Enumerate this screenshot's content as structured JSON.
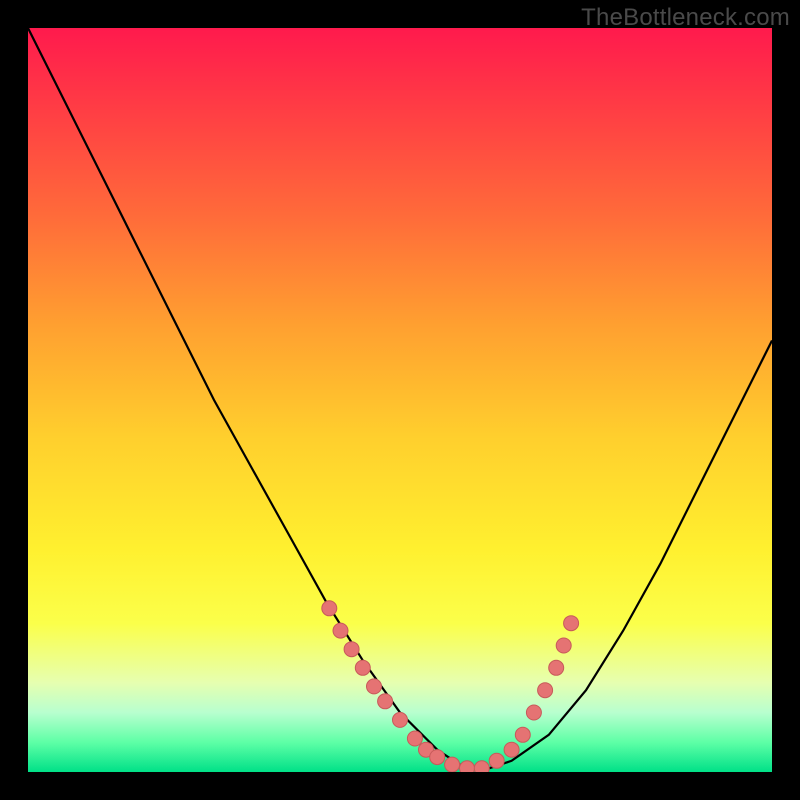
{
  "watermark": "TheBottleneck.com",
  "colors": {
    "page_bg": "#000000",
    "gradient_top": "#ff1a4d",
    "gradient_bottom": "#00e188",
    "curve": "#000000",
    "dot_fill": "#e57373",
    "dot_stroke": "#c75a5a"
  },
  "chart_data": {
    "type": "line",
    "title": "",
    "xlabel": "",
    "ylabel": "",
    "xlim": [
      0,
      100
    ],
    "ylim": [
      0,
      100
    ],
    "grid": false,
    "series": [
      {
        "name": "bottleneck-curve",
        "x": [
          0,
          5,
          10,
          15,
          20,
          25,
          30,
          35,
          40,
          45,
          50,
          55,
          58,
          60,
          62,
          65,
          70,
          75,
          80,
          85,
          90,
          95,
          100
        ],
        "y": [
          100,
          90,
          80,
          70,
          60,
          50,
          41,
          32,
          23,
          15,
          8,
          3,
          1,
          0.5,
          0.5,
          1.5,
          5,
          11,
          19,
          28,
          38,
          48,
          58
        ]
      }
    ],
    "highlight_region_x": [
      40,
      72
    ],
    "highlight_points": [
      {
        "x": 40.5,
        "y": 22
      },
      {
        "x": 42.0,
        "y": 19
      },
      {
        "x": 43.5,
        "y": 16.5
      },
      {
        "x": 45.0,
        "y": 14
      },
      {
        "x": 46.5,
        "y": 11.5
      },
      {
        "x": 48.0,
        "y": 9.5
      },
      {
        "x": 50.0,
        "y": 7
      },
      {
        "x": 52.0,
        "y": 4.5
      },
      {
        "x": 53.5,
        "y": 3
      },
      {
        "x": 55.0,
        "y": 2
      },
      {
        "x": 57.0,
        "y": 1
      },
      {
        "x": 59.0,
        "y": 0.5
      },
      {
        "x": 61.0,
        "y": 0.5
      },
      {
        "x": 63.0,
        "y": 1.5
      },
      {
        "x": 65.0,
        "y": 3
      },
      {
        "x": 66.5,
        "y": 5
      },
      {
        "x": 68.0,
        "y": 8
      },
      {
        "x": 69.5,
        "y": 11
      },
      {
        "x": 71.0,
        "y": 14
      },
      {
        "x": 72.0,
        "y": 17
      },
      {
        "x": 73.0,
        "y": 20
      }
    ]
  }
}
